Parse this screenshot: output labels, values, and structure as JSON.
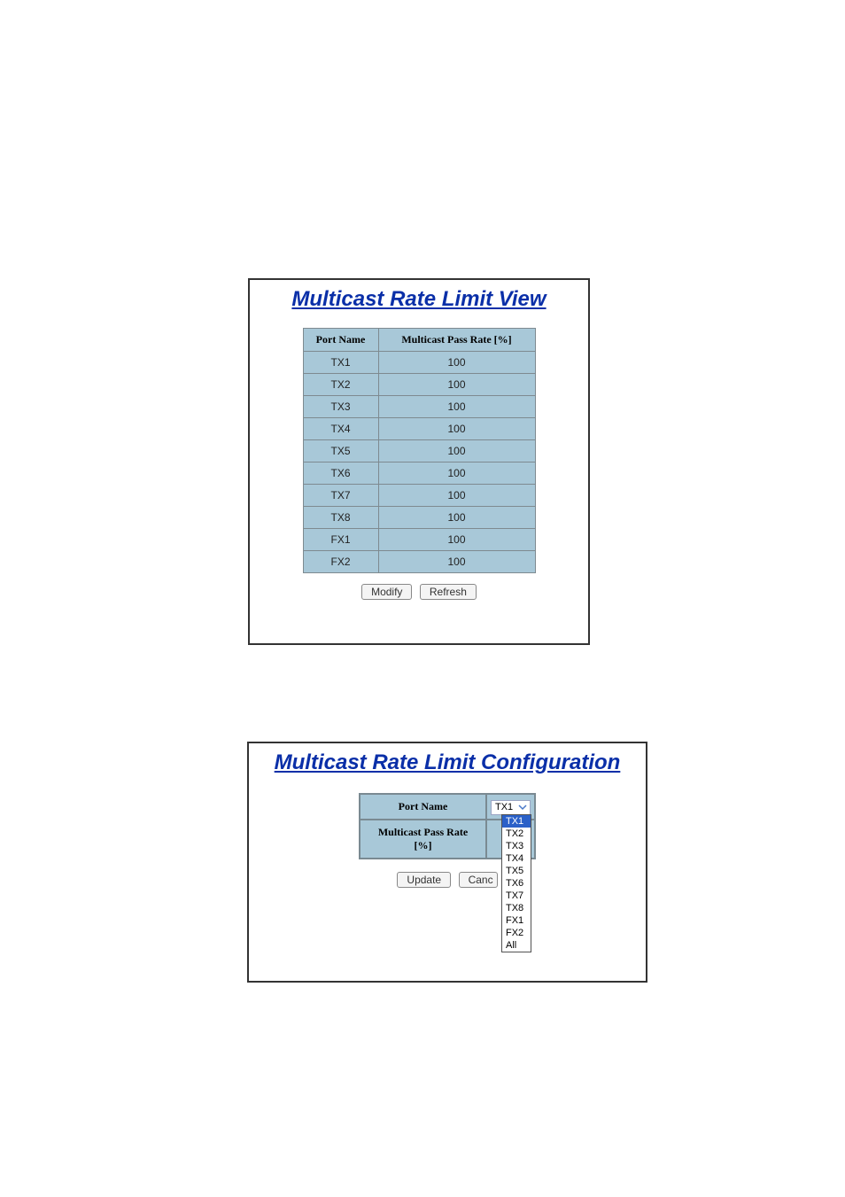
{
  "view": {
    "title": "Multicast Rate Limit View",
    "headers": {
      "port": "Port Name",
      "rate": "Multicast Pass Rate [%]"
    },
    "rows": [
      {
        "port": "TX1",
        "rate": "100"
      },
      {
        "port": "TX2",
        "rate": "100"
      },
      {
        "port": "TX3",
        "rate": "100"
      },
      {
        "port": "TX4",
        "rate": "100"
      },
      {
        "port": "TX5",
        "rate": "100"
      },
      {
        "port": "TX6",
        "rate": "100"
      },
      {
        "port": "TX7",
        "rate": "100"
      },
      {
        "port": "TX8",
        "rate": "100"
      },
      {
        "port": "FX1",
        "rate": "100"
      },
      {
        "port": "FX2",
        "rate": "100"
      }
    ],
    "buttons": {
      "modify": "Modify",
      "refresh": "Refresh"
    }
  },
  "config": {
    "title": "Multicast Rate Limit Configuration",
    "labels": {
      "port": "Port Name",
      "rate": "Multicast Pass Rate [%]"
    },
    "select": {
      "value": "TX1",
      "options": [
        "TX1",
        "TX2",
        "TX3",
        "TX4",
        "TX5",
        "TX6",
        "TX7",
        "TX8",
        "FX1",
        "FX2",
        "All"
      ],
      "selected_index": 0
    },
    "buttons": {
      "update": "Update",
      "cancel": "Cancel"
    }
  }
}
